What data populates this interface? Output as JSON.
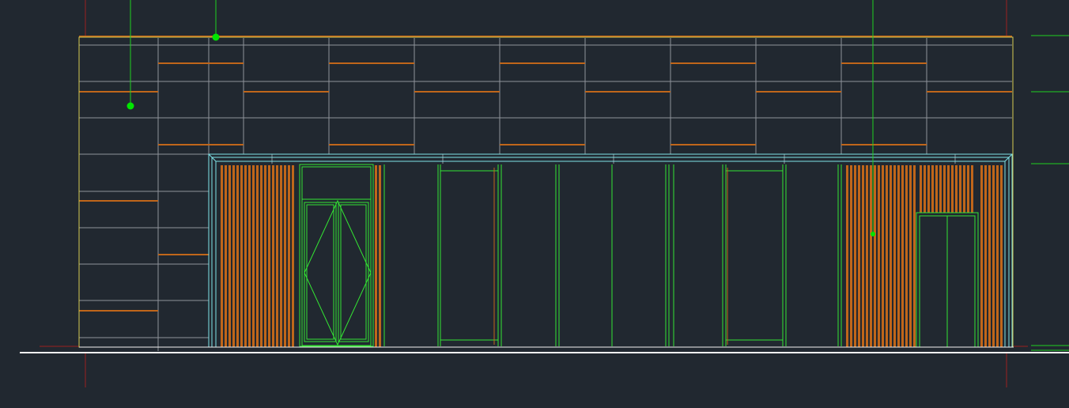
{
  "app": {
    "type": "cad-viewport",
    "view": "building-elevation"
  },
  "colors": {
    "background": "#212830",
    "panel_grid": "#8e939a",
    "wood_strip": "#c0661a",
    "outline_yellow": "#d8cc52",
    "glazing_cyan": "#7fe3e8",
    "door_green": "#33e533",
    "leader_green": "#1fd01f",
    "grip_green": "#00e600",
    "axis_red": "#9a1f1f",
    "ground_white": "#f2f2f2"
  },
  "icons": [
    "grip-point-icon"
  ],
  "edge_text": ""
}
